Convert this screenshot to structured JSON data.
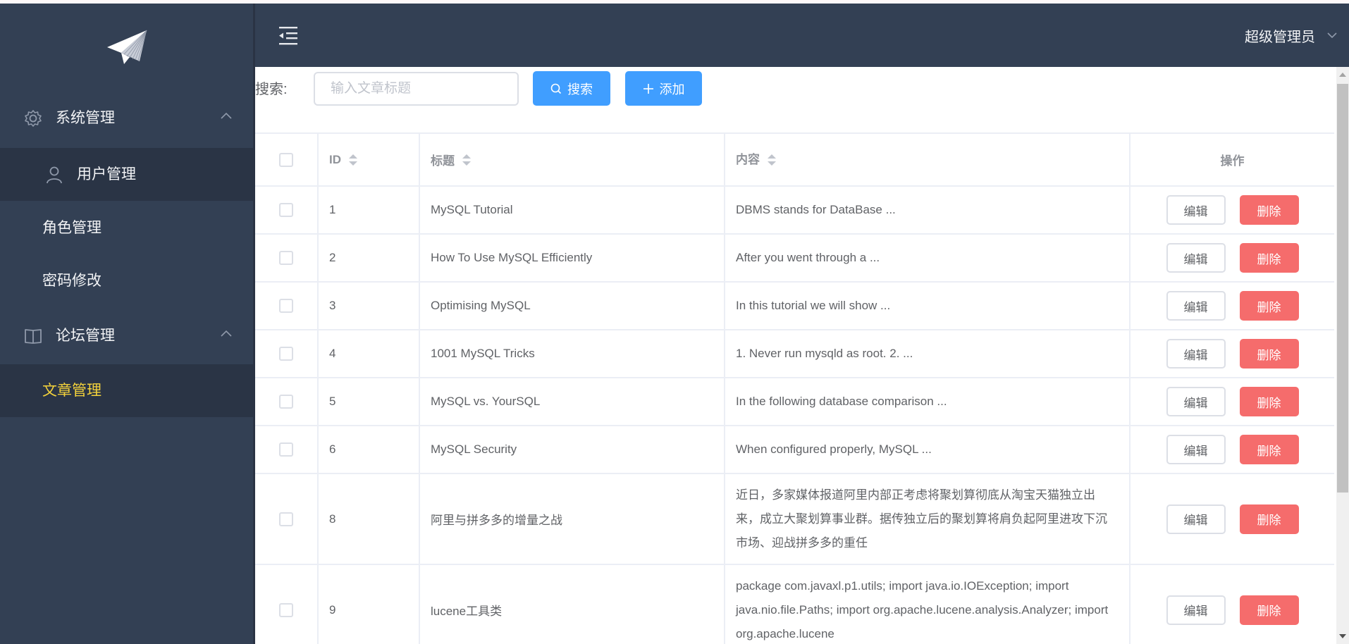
{
  "sidebar": {
    "groups": [
      {
        "label": "系统管理",
        "icon": "gear-icon",
        "expanded": true,
        "items": [
          {
            "label": "用户管理",
            "icon": "user-icon",
            "active": false,
            "hovered": true
          },
          {
            "label": "角色管理",
            "active": false
          },
          {
            "label": "密码修改",
            "active": false
          }
        ]
      },
      {
        "label": "论坛管理",
        "icon": "book-icon",
        "expanded": true,
        "items": [
          {
            "label": "文章管理",
            "active": true
          }
        ]
      }
    ]
  },
  "header": {
    "user_name": "超级管理员"
  },
  "toolbar": {
    "search_label": "搜索:",
    "search_value": "",
    "search_placeholder": "输入文章标题",
    "search_button": "搜索",
    "add_button": "添加"
  },
  "table": {
    "columns": [
      "ID",
      "标题",
      "内容",
      "操作"
    ],
    "edit_label": "编辑",
    "delete_label": "删除",
    "rows": [
      {
        "id": "1",
        "title": "MySQL Tutorial",
        "content": "DBMS stands for DataBase ..."
      },
      {
        "id": "2",
        "title": "How To Use MySQL Efficiently",
        "content": "After you went through a ..."
      },
      {
        "id": "3",
        "title": "Optimising MySQL",
        "content": "In this tutorial we will show ..."
      },
      {
        "id": "4",
        "title": "1001 MySQL Tricks",
        "content": "1. Never run mysqld as root. 2. ..."
      },
      {
        "id": "5",
        "title": "MySQL vs. YourSQL",
        "content": "In the following database comparison ..."
      },
      {
        "id": "6",
        "title": "MySQL Security",
        "content": "When configured properly, MySQL ..."
      },
      {
        "id": "8",
        "title": "阿里与拼多多的增量之战",
        "content": "近日，多家媒体报道阿里内部正考虑将聚划算彻底从淘宝天猫独立出来，成立大聚划算事业群。据传独立后的聚划算将肩负起阿里进攻下沉市场、迎战拼多多的重任"
      },
      {
        "id": "9",
        "title": "lucene工具类",
        "content": "package com.javaxl.p1.utils; import java.io.IOException; import java.nio.file.Paths; import org.apache.lucene.analysis.Analyzer; import org.apache.lucene"
      }
    ]
  },
  "colors": {
    "sidebar_bg": "#334054",
    "sidebar_active_bg": "#2a3445",
    "active_text": "#f5d33b",
    "primary": "#409eff",
    "danger": "#f56c6c"
  }
}
